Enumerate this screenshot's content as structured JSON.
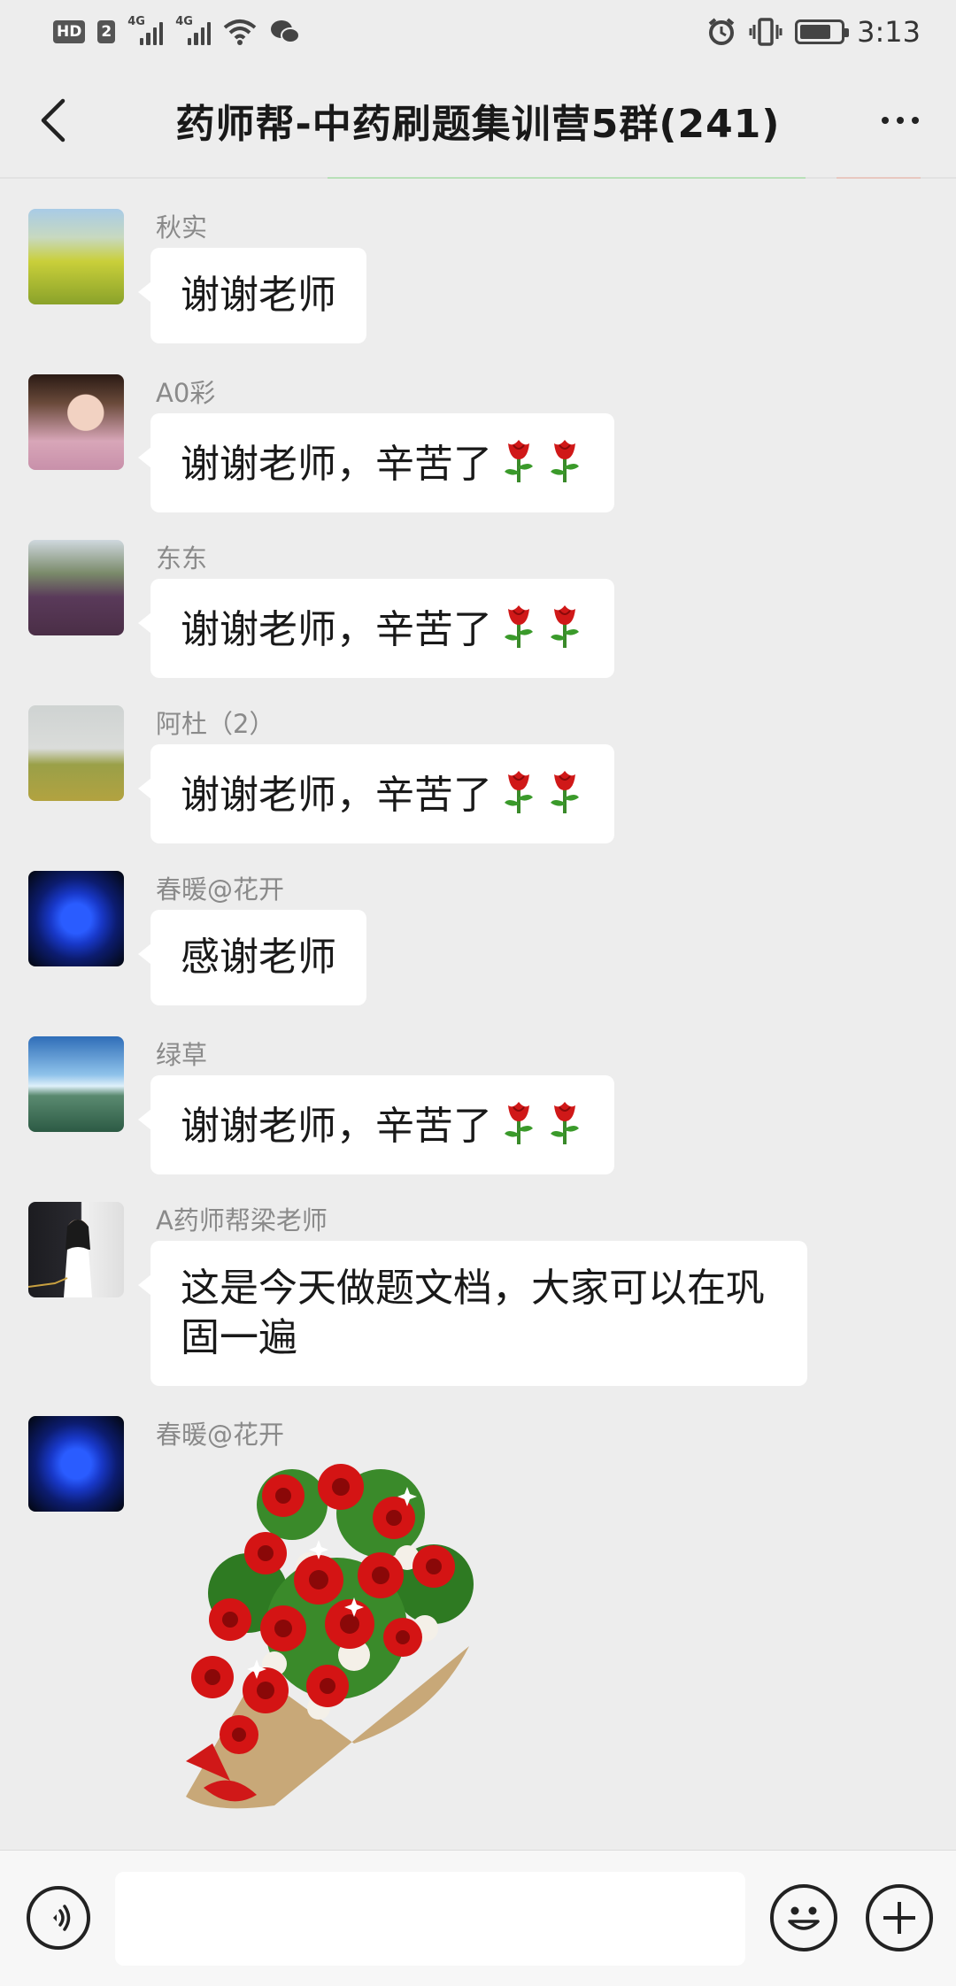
{
  "status_bar": {
    "hd_label": "HD",
    "sim_label": "2",
    "net1": "4G",
    "net2": "4G",
    "time": "3:13"
  },
  "header": {
    "title": "药师帮-中药刷题集训营5群(241)"
  },
  "messages": [
    {
      "sender": "秋实",
      "text": "谢谢老师",
      "avatar": "field-photo",
      "roses": 0
    },
    {
      "sender": "A0彩",
      "text": "谢谢老师，辛苦了",
      "avatar": "woman-portrait",
      "roses": 2
    },
    {
      "sender": "东东",
      "text": "谢谢老师，辛苦了",
      "avatar": "mountain-flowers",
      "roses": 2
    },
    {
      "sender": "阿杜（2）",
      "text": "谢谢老师，辛苦了",
      "avatar": "rice-field",
      "roses": 2
    },
    {
      "sender": "春暖@花开",
      "text": "感谢老师",
      "avatar": "blue-rose",
      "roses": 0
    },
    {
      "sender": "绿草",
      "text": "谢谢老师，辛苦了",
      "avatar": "lake-sky",
      "roses": 2
    },
    {
      "sender": "A药师帮梁老师",
      "text_line1": "这是今天做题文档，大家可以在巩",
      "text_line2": "固一遍",
      "avatar": "teacher-portrait",
      "roses": 0
    },
    {
      "sender": "春暖@花开",
      "sticker": "rose-bouquet",
      "avatar": "blue-rose"
    }
  ],
  "input_bar": {
    "value": "",
    "icons": [
      "voice-icon",
      "emoji-icon",
      "plus-icon"
    ]
  },
  "colors": {
    "background": "#ededed",
    "bubble": "#ffffff",
    "sender_name": "#8a8a8a"
  }
}
